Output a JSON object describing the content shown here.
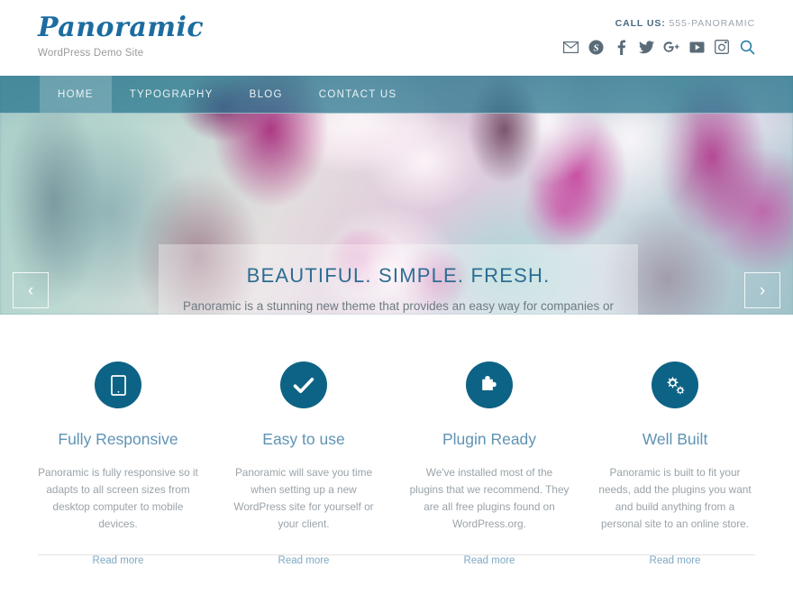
{
  "header": {
    "brand_title": "Panoramic",
    "brand_tagline": "WordPress Demo Site",
    "call_label": "CALL US:",
    "call_number": "555-PANORAMIC",
    "social": [
      {
        "name": "email-icon",
        "title": "Email"
      },
      {
        "name": "skype-icon",
        "title": "Skype"
      },
      {
        "name": "facebook-icon",
        "title": "Facebook"
      },
      {
        "name": "twitter-icon",
        "title": "Twitter"
      },
      {
        "name": "google-plus-icon",
        "title": "Google Plus"
      },
      {
        "name": "youtube-icon",
        "title": "YouTube"
      },
      {
        "name": "instagram-icon",
        "title": "Instagram"
      },
      {
        "name": "search-icon",
        "title": "Search"
      }
    ]
  },
  "nav": {
    "items": [
      {
        "label": "HOME",
        "active": true
      },
      {
        "label": "TYPOGRAPHY",
        "active": false
      },
      {
        "label": "BLOG",
        "active": false
      },
      {
        "label": "CONTACT US",
        "active": false
      }
    ]
  },
  "hero": {
    "slide_title": "BEAUTIFUL. SIMPLE. FRESH.",
    "slide_desc": "Panoramic is a stunning new theme that provides an easy way for companies or web developers to spring into action online!",
    "prev_arrow": "‹",
    "next_arrow": "›",
    "dots": [
      {
        "active": true
      },
      {
        "active": false
      },
      {
        "active": false
      }
    ]
  },
  "features": [
    {
      "icon": "tablet-icon",
      "title": "Fully Responsive",
      "desc": "Panoramic is fully responsive so it adapts to all screen sizes from desktop computer to mobile devices.",
      "link": "Read more"
    },
    {
      "icon": "check-icon",
      "title": "Easy to use",
      "desc": "Panoramic will save you time when setting up a new WordPress site for yourself or your client.",
      "link": "Read more"
    },
    {
      "icon": "puzzle-piece-icon",
      "title": "Plugin Ready",
      "desc": "We've installed most of the plugins that we recommend. They are all free plugins found on WordPress.org.",
      "link": "Read more"
    },
    {
      "icon": "cogs-icon",
      "title": "Well Built",
      "desc": "Panoramic is built to fit your needs, add the plugins you want and build anything from a personal site to an online store.",
      "link": "Read more"
    }
  ],
  "colors": {
    "brand_blue": "#1c6ca0",
    "icon_circle": "#0d6385",
    "nav_bar": "#26748e",
    "heading_blue": "#5f93b4",
    "body_gray": "#9aa3a9"
  }
}
